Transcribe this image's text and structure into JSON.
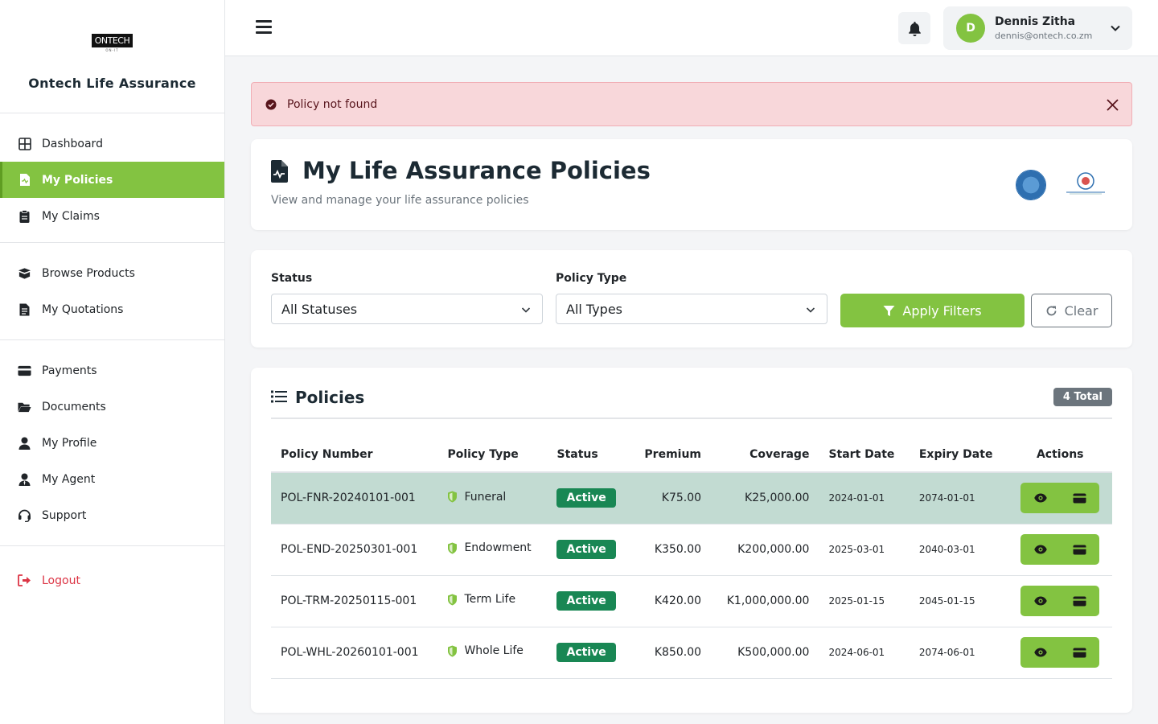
{
  "brand": {
    "logo_text": "ONTECH",
    "logo_sub": "ON-IT",
    "name": "Ontech Life Assurance"
  },
  "nav": {
    "group1": [
      {
        "label": "Dashboard",
        "icon": "grid-icon"
      },
      {
        "label": "My Policies",
        "icon": "file-medical-icon",
        "active": true
      },
      {
        "label": "My Claims",
        "icon": "clipboard-icon"
      }
    ],
    "group2": [
      {
        "label": "Browse Products",
        "icon": "box-open-icon"
      },
      {
        "label": "My Quotations",
        "icon": "file-invoice-icon"
      }
    ],
    "group3": [
      {
        "label": "Payments",
        "icon": "credit-card-icon"
      },
      {
        "label": "Documents",
        "icon": "folder-open-icon"
      },
      {
        "label": "My Profile",
        "icon": "user-icon"
      },
      {
        "label": "My Agent",
        "icon": "user-tie-icon"
      },
      {
        "label": "Support",
        "icon": "headset-icon"
      }
    ],
    "logout": "Logout"
  },
  "topbar": {
    "user": {
      "initial": "D",
      "name": "Dennis Zitha",
      "email": "dennis@ontech.co.zm"
    }
  },
  "alert": {
    "message": "Policy not found"
  },
  "header": {
    "title": "My Life Assurance Policies",
    "subtitle": "View and manage your life assurance policies"
  },
  "filters": {
    "status_label": "Status",
    "status_value": "All Statuses",
    "type_label": "Policy Type",
    "type_value": "All Types",
    "apply_label": "Apply Filters",
    "clear_label": "Clear"
  },
  "policies": {
    "title": "Policies",
    "total_badge": "4 Total",
    "columns": [
      "Policy Number",
      "Policy Type",
      "Status",
      "Premium",
      "Coverage",
      "Start Date",
      "Expiry Date",
      "Actions"
    ],
    "rows": [
      {
        "number": "POL-FNR-20240101-001",
        "type": "Funeral",
        "status": "Active",
        "premium": "K75.00",
        "coverage": "K25,000.00",
        "start": "2024-01-01",
        "expiry": "2074-01-01"
      },
      {
        "number": "POL-END-20250301-001",
        "type": "Endowment",
        "status": "Active",
        "premium": "K350.00",
        "coverage": "K200,000.00",
        "start": "2025-03-01",
        "expiry": "2040-03-01"
      },
      {
        "number": "POL-TRM-20250115-001",
        "type": "Term Life",
        "status": "Active",
        "premium": "K420.00",
        "coverage": "K1,000,000.00",
        "start": "2025-01-15",
        "expiry": "2045-01-15"
      },
      {
        "number": "POL-WHL-20260101-001",
        "type": "Whole Life",
        "status": "Active",
        "premium": "K850.00",
        "coverage": "K500,000.00",
        "start": "2024-06-01",
        "expiry": "2074-06-01"
      }
    ]
  },
  "colors": {
    "accent": "#83c341",
    "status_active": "#198754",
    "alert_bg": "#f8d7da",
    "highlight_row": "#c2dbd2"
  }
}
